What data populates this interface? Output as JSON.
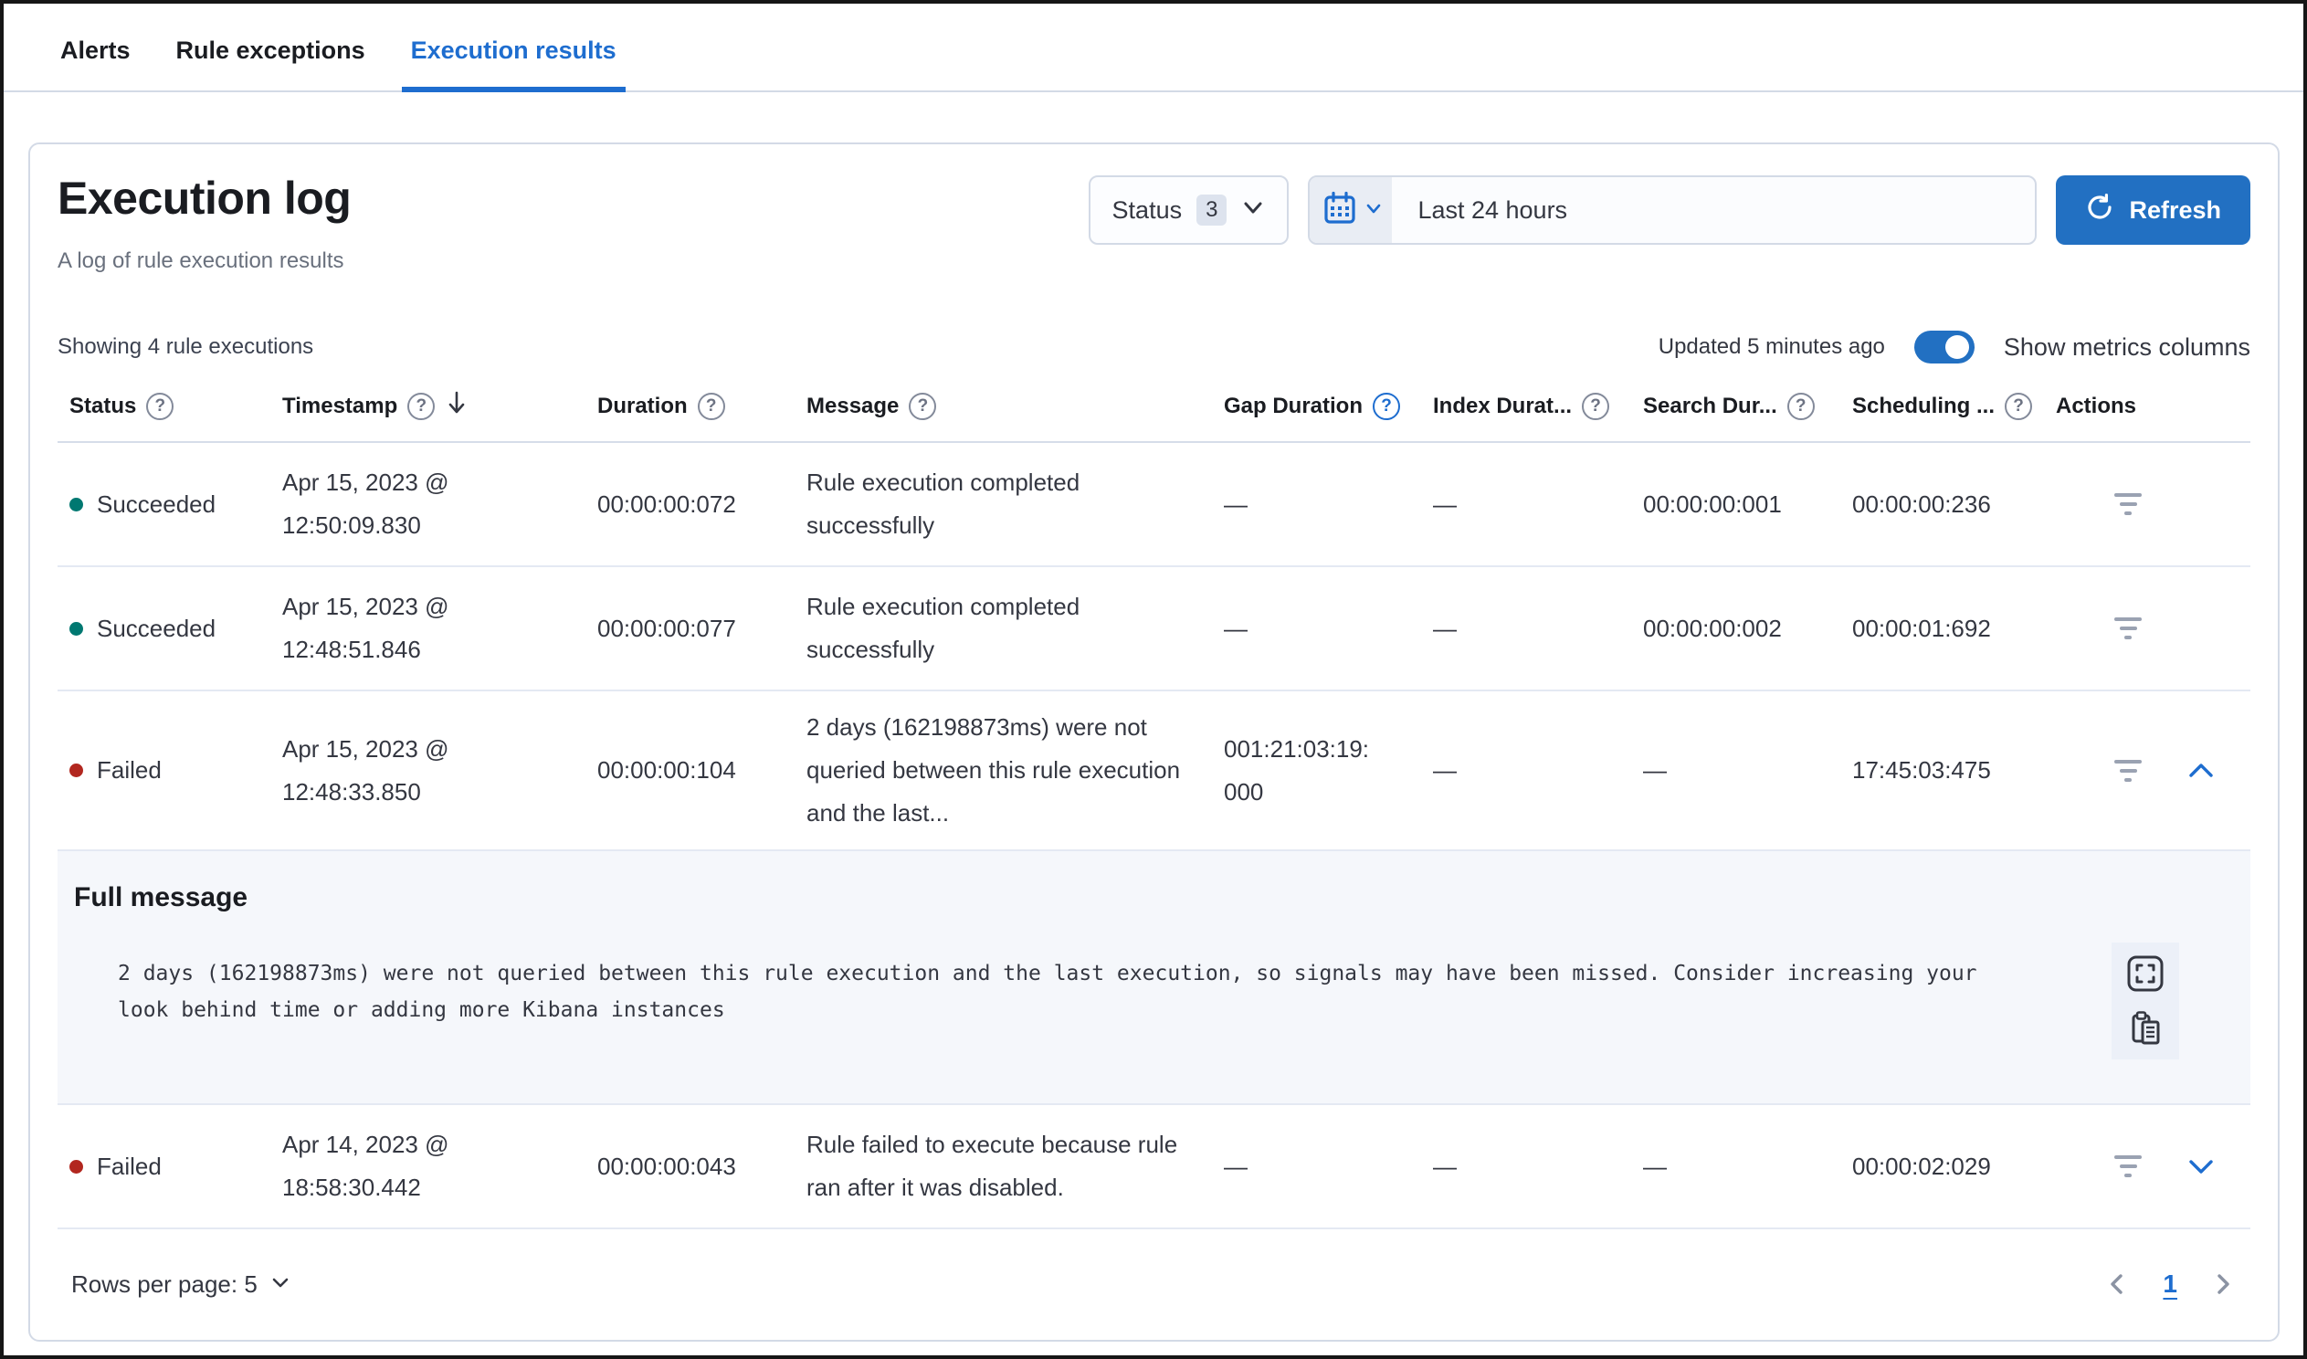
{
  "tabs": [
    {
      "label": "Alerts",
      "active": false
    },
    {
      "label": "Rule exceptions",
      "active": false
    },
    {
      "label": "Execution results",
      "active": true
    }
  ],
  "panel": {
    "title": "Execution log",
    "subtitle": "A log of rule execution results",
    "filters": {
      "status_label": "Status",
      "status_count": "3",
      "date_range": "Last 24 hours",
      "refresh_label": "Refresh"
    },
    "meta": {
      "showing": "Showing 4 rule executions",
      "updated": "Updated 5 minutes ago",
      "metrics_toggle_label": "Show metrics columns",
      "metrics_toggle_on": true
    },
    "table": {
      "columns": [
        {
          "label": "Status"
        },
        {
          "label": "Timestamp"
        },
        {
          "label": "Duration"
        },
        {
          "label": "Message"
        },
        {
          "label": "Gap Duration"
        },
        {
          "label": "Index Durat..."
        },
        {
          "label": "Search Dur..."
        },
        {
          "label": "Scheduling ..."
        },
        {
          "label": "Actions"
        }
      ],
      "rows": [
        {
          "status": "Succeeded",
          "timestamp_date": "Apr 15, 2023 @",
          "timestamp_time": "12:50:09.830",
          "duration": "00:00:00:072",
          "message": "Rule execution completed successfully",
          "gap_duration": "—",
          "index_duration": "—",
          "search_duration": "00:00:00:001",
          "scheduling_delay": "00:00:00:236"
        },
        {
          "status": "Succeeded",
          "timestamp_date": "Apr 15, 2023 @",
          "timestamp_time": "12:48:51.846",
          "duration": "00:00:00:077",
          "message": "Rule execution completed successfully",
          "gap_duration": "—",
          "index_duration": "—",
          "search_duration": "00:00:00:002",
          "scheduling_delay": "00:00:01:692"
        },
        {
          "status": "Failed",
          "timestamp_date": "Apr 15, 2023 @",
          "timestamp_time": "12:48:33.850",
          "duration": "00:00:00:104",
          "message": "2 days (162198873ms) were not queried between this rule execution and the last...",
          "gap_duration": "001:21:03:19:000",
          "index_duration": "—",
          "search_duration": "—",
          "scheduling_delay": "17:45:03:475",
          "expanded": true
        },
        {
          "status": "Failed",
          "timestamp_date": "Apr 14, 2023 @",
          "timestamp_time": "18:58:30.442",
          "duration": "00:00:00:043",
          "message": "Rule failed to execute because rule ran after it was disabled.",
          "gap_duration": "—",
          "index_duration": "—",
          "search_duration": "—",
          "scheduling_delay": "00:00:02:029",
          "expanded": false
        }
      ],
      "expanded_row": {
        "title": "Full message",
        "message": "2 days (162198873ms) were not queried between this rule execution and the last execution, so signals may have been missed. Consider increasing your look behind time or adding more Kibana instances"
      }
    },
    "footer": {
      "rows_per_page": "Rows per page: 5",
      "current_page": "1"
    }
  },
  "colors": {
    "accent_blue": "#1e6dcf",
    "button_blue": "#2270c2",
    "success_green": "#007871",
    "danger_red": "#b2271f",
    "panel_border": "#d3dae6",
    "row_divider": "#e4e9f3",
    "expanded_bg": "#f5f7fb"
  }
}
